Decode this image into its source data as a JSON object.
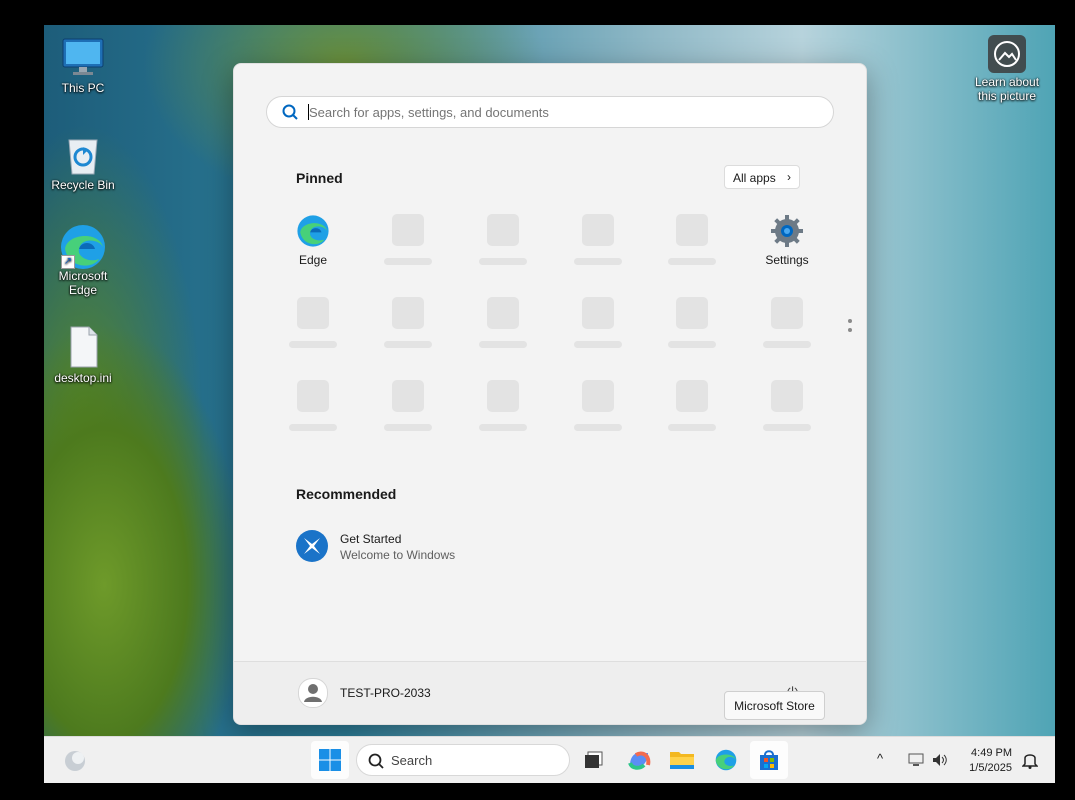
{
  "desktop": {
    "icons": [
      {
        "label": "This PC"
      },
      {
        "label": "Recycle Bin"
      },
      {
        "label": "Microsoft Edge"
      },
      {
        "label": "desktop.ini"
      }
    ],
    "learn_about": {
      "label": "Learn about this picture"
    }
  },
  "start_menu": {
    "search_placeholder": "Search for apps, settings, and documents",
    "pinned_title": "Pinned",
    "all_apps_label": "All apps",
    "pinned_apps": [
      {
        "label": "Edge"
      },
      {
        "label": "Settings"
      }
    ],
    "recommended_title": "Recommended",
    "recommended": [
      {
        "title": "Get Started",
        "subtitle": "Welcome to Windows"
      }
    ],
    "user_name": "TEST-PRO-2033",
    "tooltip": "Microsoft Store"
  },
  "taskbar": {
    "search_label": "Search",
    "time": "4:49 PM",
    "date": "1/5/2025",
    "icons": [
      "widgets-icon",
      "start-icon",
      "search-icon",
      "task-view-icon",
      "copilot-icon",
      "file-explorer-icon",
      "edge-icon",
      "microsoft-store-icon",
      "chevron-up-icon",
      "network-icon",
      "volume-icon",
      "notification-icon"
    ]
  },
  "colors": {
    "accent": "#0067c0",
    "start_bg": "#f3f3f3",
    "taskbar_bg": "#f0f0f0"
  }
}
